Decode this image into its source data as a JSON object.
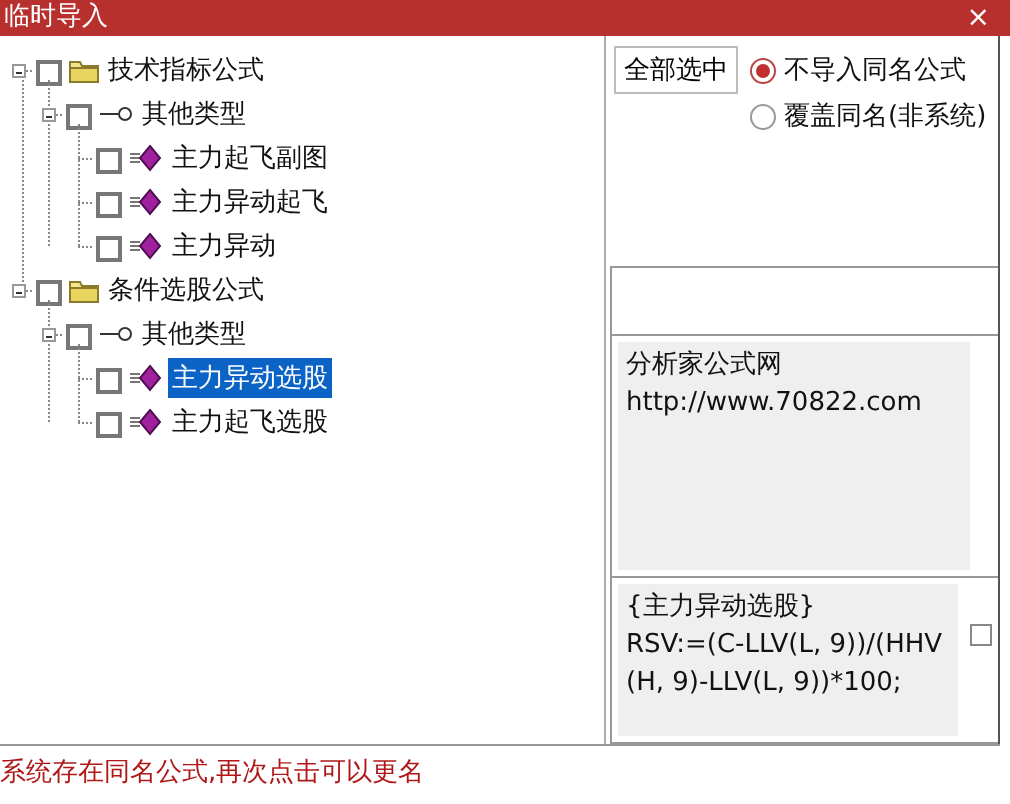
{
  "window": {
    "title": "临时导入",
    "close": "×"
  },
  "tree": [
    {
      "label": "技术指标公式",
      "kind": "folder",
      "expanded": true,
      "checked": false,
      "children": [
        {
          "label": "其他类型",
          "kind": "type",
          "expanded": true,
          "checked": false,
          "children": [
            {
              "label": "主力起飞副图",
              "kind": "formula",
              "checked": false,
              "selected": false
            },
            {
              "label": "主力异动起飞",
              "kind": "formula",
              "checked": false,
              "selected": false
            },
            {
              "label": "主力异动",
              "kind": "formula",
              "checked": false,
              "selected": false
            }
          ]
        }
      ]
    },
    {
      "label": "条件选股公式",
      "kind": "folder",
      "expanded": true,
      "checked": false,
      "children": [
        {
          "label": "其他类型",
          "kind": "type",
          "expanded": true,
          "checked": false,
          "children": [
            {
              "label": "主力异动选股",
              "kind": "formula",
              "checked": false,
              "selected": true
            },
            {
              "label": "主力起飞选股",
              "kind": "formula",
              "checked": false,
              "selected": false
            }
          ]
        }
      ]
    }
  ],
  "select_all_button": "全部选中",
  "options": [
    {
      "label": "不导入同名公式",
      "selected": true
    },
    {
      "label": "覆盖同名(非系统)",
      "selected": false
    }
  ],
  "info": [
    "分析家公式网",
    "http://www.70822.com"
  ],
  "formula": {
    "lines": [
      "{主力异动选股}",
      "RSV:=(C-LLV(L, 9))/(HHV",
      "(H, 9)-LLV(L, 9))*100;"
    ],
    "checked": false
  },
  "status": "系统存在同名公式,再次点击可以更名"
}
